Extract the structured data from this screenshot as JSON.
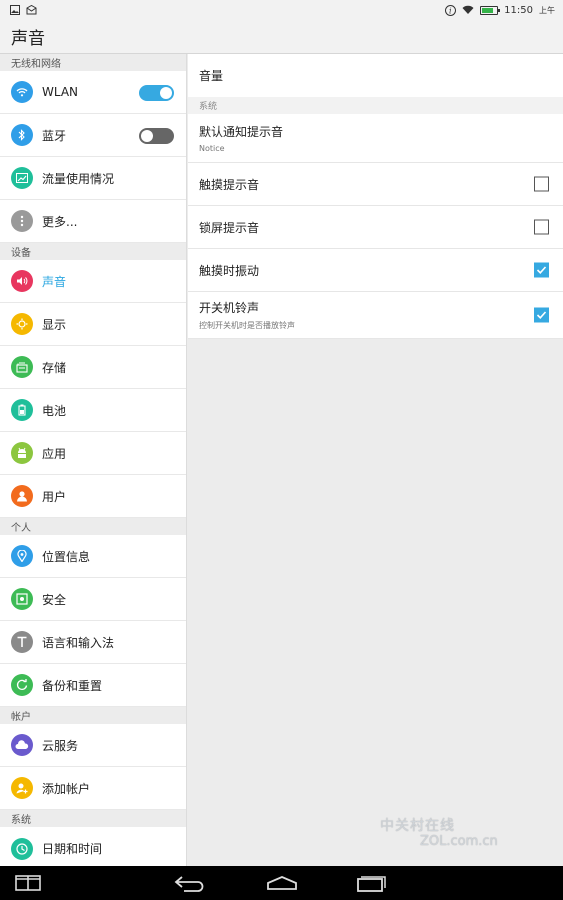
{
  "status_bar": {
    "time": "11:50",
    "ampm": "上午",
    "battery_level": 0.75
  },
  "title_bar": {
    "title": "声音"
  },
  "left_nav": {
    "sections": [
      {
        "header": "无线和网络",
        "items": [
          {
            "label": "WLAN",
            "icon": "wifi-icon",
            "color": "#2f9ee8",
            "toggle": "on"
          },
          {
            "label": "蓝牙",
            "icon": "bluetooth-icon",
            "color": "#2f9ee8",
            "toggle": "off"
          },
          {
            "label": "流量使用情况",
            "icon": "data-usage-icon",
            "color": "#1fbf9a"
          },
          {
            "label": "更多...",
            "icon": "more-icon",
            "color": "#9a9a9a"
          }
        ]
      },
      {
        "header": "设备",
        "items": [
          {
            "label": "声音",
            "icon": "sound-icon",
            "color": "#e8365f",
            "active": true
          },
          {
            "label": "显示",
            "icon": "display-icon",
            "color": "#f5b800"
          },
          {
            "label": "存储",
            "icon": "storage-icon",
            "color": "#3dbb55"
          },
          {
            "label": "电池",
            "icon": "battery-icon",
            "color": "#1fbf9a"
          },
          {
            "label": "应用",
            "icon": "apps-icon",
            "color": "#8cc63f"
          },
          {
            "label": "用户",
            "icon": "user-icon",
            "color": "#f26b1d"
          }
        ]
      },
      {
        "header": "个人",
        "items": [
          {
            "label": "位置信息",
            "icon": "location-icon",
            "color": "#2f9ee8"
          },
          {
            "label": "安全",
            "icon": "security-icon",
            "color": "#3dbb55"
          },
          {
            "label": "语言和输入法",
            "icon": "language-icon",
            "color": "#8a8a8a"
          },
          {
            "label": "备份和重置",
            "icon": "backup-icon",
            "color": "#3dbb55"
          }
        ]
      },
      {
        "header": "帐户",
        "items": [
          {
            "label": "云服务",
            "icon": "cloud-icon",
            "color": "#6a5acd"
          },
          {
            "label": "添加帐户",
            "icon": "add-account-icon",
            "color": "#f5b800"
          }
        ]
      },
      {
        "header": "系统",
        "items": [
          {
            "label": "日期和时间",
            "icon": "clock-icon",
            "color": "#1fbf9a"
          }
        ]
      }
    ]
  },
  "right_pane": {
    "volume_label": "音量",
    "system_header": "系统",
    "default_tone": {
      "title": "默认通知提示音",
      "subtitle": "Notice"
    },
    "options": [
      {
        "title": "触摸提示音",
        "checked": false
      },
      {
        "title": "锁屏提示音",
        "checked": false
      },
      {
        "title": "触摸时振动",
        "checked": true
      },
      {
        "title": "开关机铃声",
        "subtitle": "控制开关机时是否播放铃声",
        "checked": true
      }
    ]
  },
  "watermark": {
    "line1": "中关村在线",
    "line2": "ZOL.com.cn"
  },
  "colors": {
    "accent": "#36a9e1",
    "active_text": "#2aa6e0"
  }
}
